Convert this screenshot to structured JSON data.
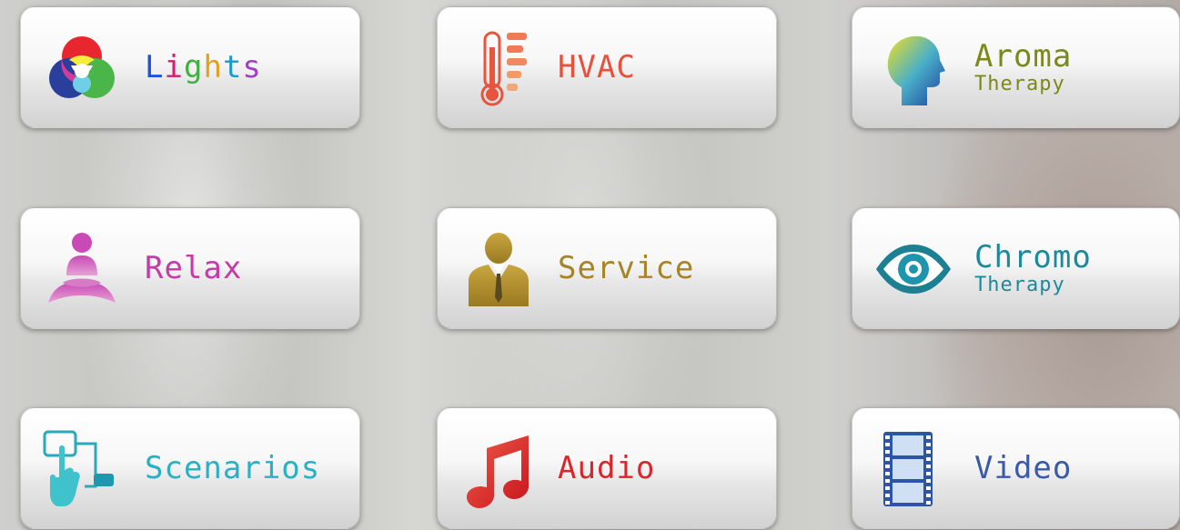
{
  "tiles": [
    {
      "label": "Lights",
      "icon": "rgb-circles-icon"
    },
    {
      "label": "HVAC",
      "icon": "thermometer-icon",
      "color": "#e8503a"
    },
    {
      "label": "Aroma",
      "sublabel": "Therapy",
      "icon": "head-profile-icon",
      "color": "#7a8a18"
    },
    {
      "label": "Relax",
      "icon": "meditation-icon",
      "color": "#c43aa8"
    },
    {
      "label": "Service",
      "icon": "waiter-icon",
      "color": "#a68428"
    },
    {
      "label": "Chromo",
      "sublabel": "Therapy",
      "icon": "eye-icon",
      "color": "#1d8a9c"
    },
    {
      "label": "Scenarios",
      "icon": "touch-scenario-icon",
      "color": "#2ab0c4"
    },
    {
      "label": "Audio",
      "icon": "music-note-icon",
      "color": "#d8262b"
    },
    {
      "label": "Video",
      "icon": "film-strip-icon",
      "color": "#3a5aa8"
    }
  ],
  "lights_letter_colors": [
    "#2050e0",
    "#d02070",
    "#40b040",
    "#e0a020",
    "#1a9ad0",
    "#a040c0"
  ]
}
